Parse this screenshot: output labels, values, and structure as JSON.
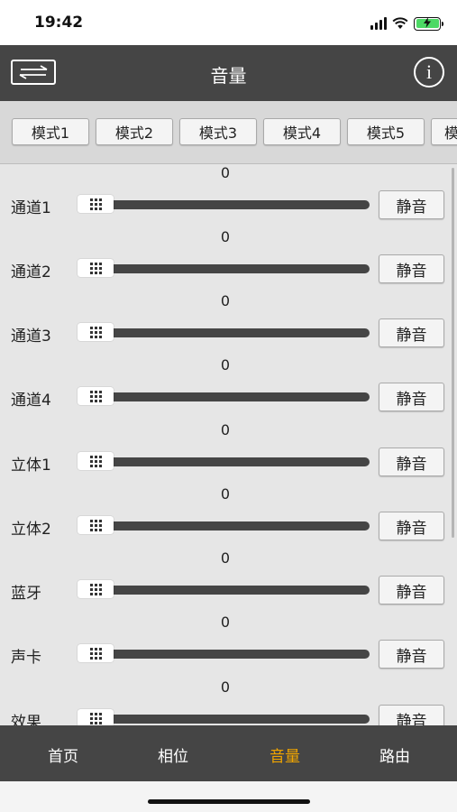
{
  "status": {
    "time": "19:42",
    "battery_color": "#4cd964"
  },
  "header": {
    "title": "音量",
    "left_icon": "swap-arrows-icon",
    "right_icon": "info-icon",
    "info_glyph": "i"
  },
  "modes": [
    "模式1",
    "模式2",
    "模式3",
    "模式4",
    "模式5",
    "模"
  ],
  "channels": [
    {
      "label": "通道1",
      "value": "0",
      "mute_label": "静音",
      "level": 0
    },
    {
      "label": "通道2",
      "value": "0",
      "mute_label": "静音",
      "level": 0
    },
    {
      "label": "通道3",
      "value": "0",
      "mute_label": "静音",
      "level": 0
    },
    {
      "label": "通道4",
      "value": "0",
      "mute_label": "静音",
      "level": 0
    },
    {
      "label": "立体1",
      "value": "0",
      "mute_label": "静音",
      "level": 0
    },
    {
      "label": "立体2",
      "value": "0",
      "mute_label": "静音",
      "level": 0
    },
    {
      "label": "蓝牙",
      "value": "0",
      "mute_label": "静音",
      "level": 0
    },
    {
      "label": "声卡",
      "value": "0",
      "mute_label": "静音",
      "level": 0
    },
    {
      "label": "效果",
      "value": "0",
      "mute_label": "静音",
      "level": 0
    }
  ],
  "tabs": [
    {
      "label": "首页",
      "active": false
    },
    {
      "label": "相位",
      "active": false
    },
    {
      "label": "音量",
      "active": true
    },
    {
      "label": "路由",
      "active": false
    }
  ],
  "colors": {
    "bar": "#454545",
    "active_tab": "#f0a500"
  }
}
